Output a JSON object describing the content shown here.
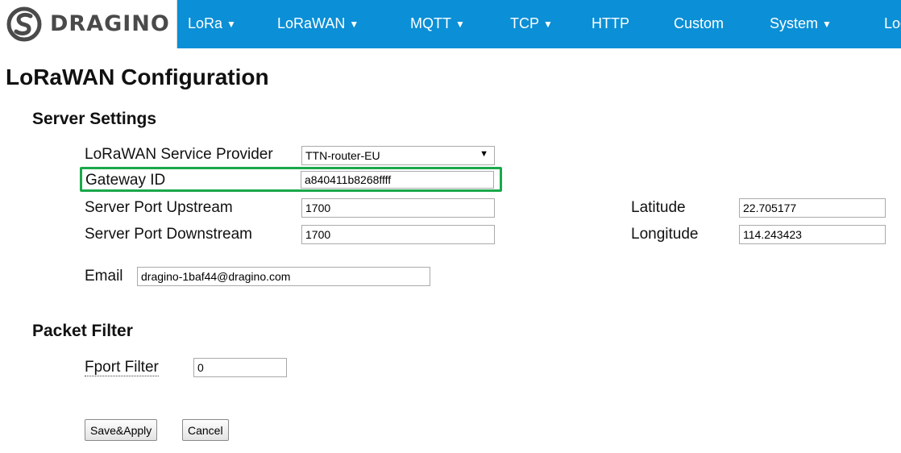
{
  "nav": {
    "logo_text": "DRAGINO",
    "items": [
      {
        "label": "LoRa",
        "dropdown": true
      },
      {
        "label": "LoRaWAN",
        "dropdown": true
      },
      {
        "label": "MQTT",
        "dropdown": true
      },
      {
        "label": "TCP",
        "dropdown": true
      },
      {
        "label": "HTTP",
        "dropdown": false
      },
      {
        "label": "Custom",
        "dropdown": false
      },
      {
        "label": "System",
        "dropdown": true
      },
      {
        "label": "Log",
        "dropdown": false
      }
    ],
    "caret": "▼"
  },
  "page": {
    "title": "LoRaWAN Configuration"
  },
  "server_settings": {
    "title": "Server Settings",
    "provider_label": "LoRaWAN Service Provider",
    "provider_value": "TTN-router-EU",
    "gateway_id_label": "Gateway ID",
    "gateway_id_value": "a840411b8268ffff",
    "port_up_label": "Server Port Upstream",
    "port_up_value": "1700",
    "port_down_label": "Server Port Downstream",
    "port_down_value": "1700",
    "latitude_label": "Latitude",
    "latitude_value": "22.705177",
    "longitude_label": "Longitude",
    "longitude_value": "114.243423",
    "email_label": "Email",
    "email_value": "dragino-1baf44@dragino.com"
  },
  "packet_filter": {
    "title": "Packet Filter",
    "fport_label": "Fport Filter",
    "fport_value": "0"
  },
  "actions": {
    "save_label": "Save&Apply",
    "cancel_label": "Cancel"
  },
  "colors": {
    "navbar": "#0b8fd6",
    "highlight": "#1aa84b"
  }
}
